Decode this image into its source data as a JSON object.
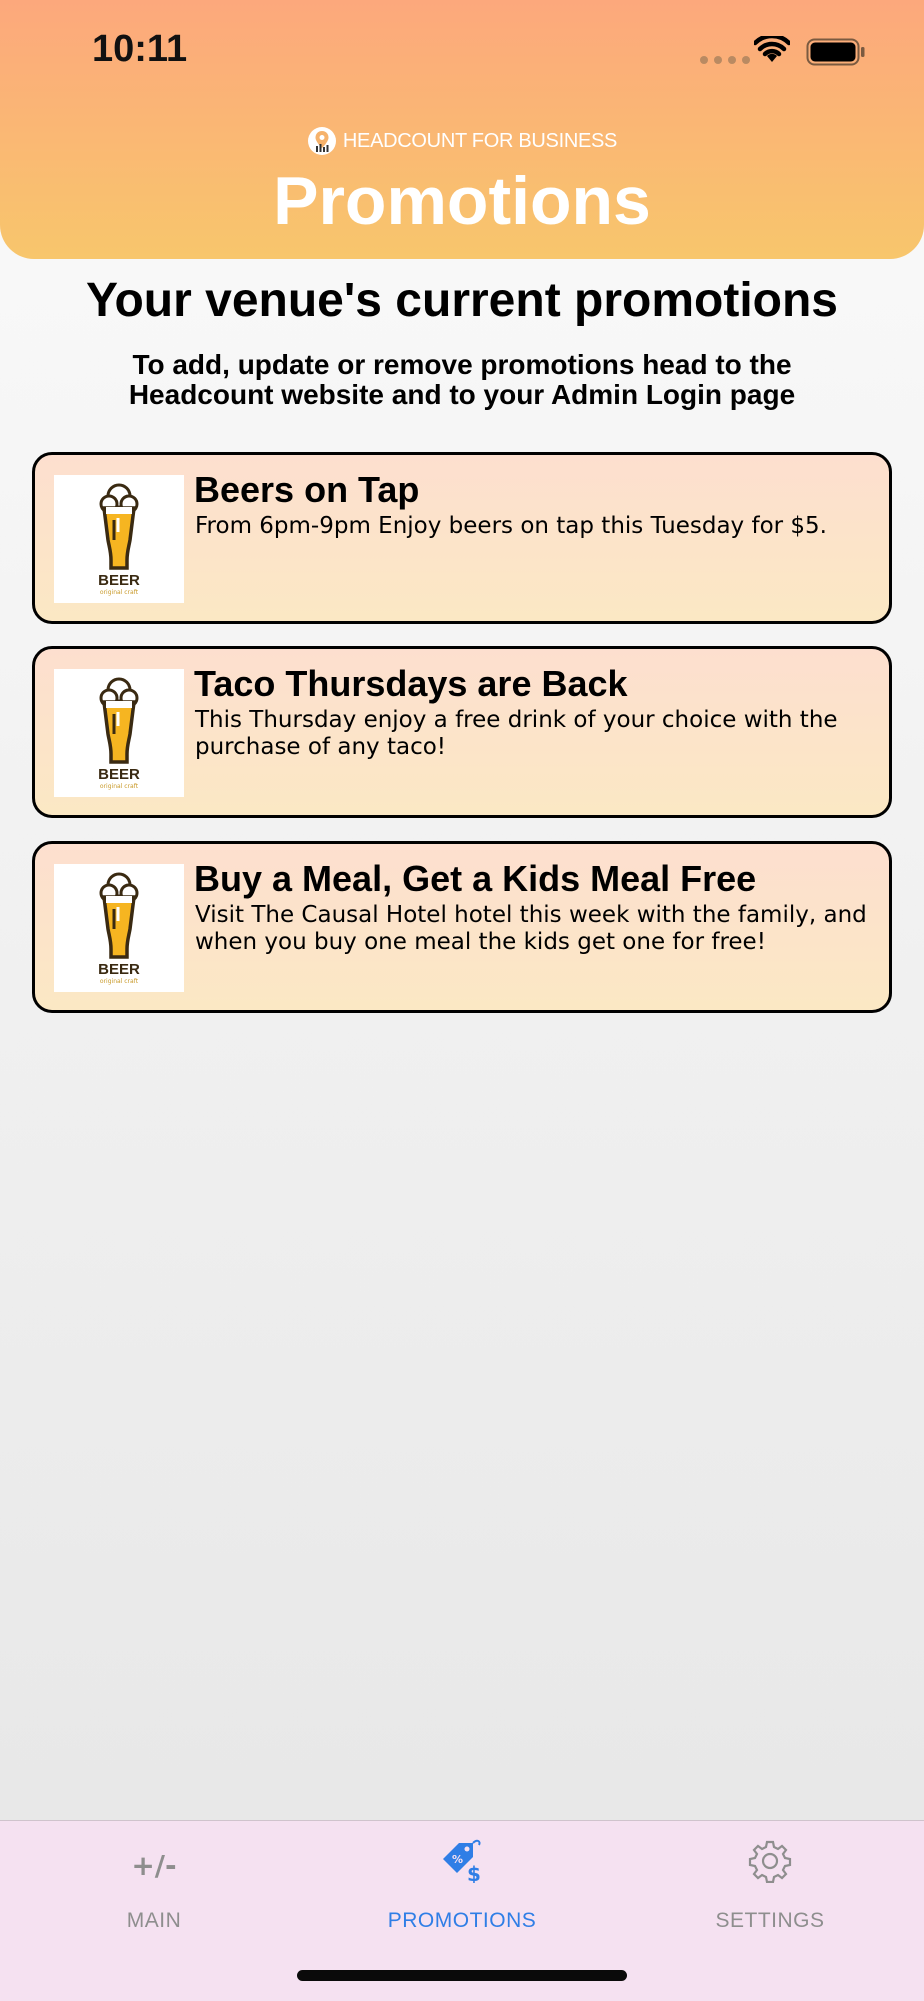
{
  "status_bar": {
    "time": "10:11"
  },
  "header": {
    "brand": "HEADCOUNT FOR BUSINESS",
    "title": "Promotions"
  },
  "intro": {
    "title": "Your venue's current promotions",
    "subtitle": "To add, update or remove promotions head to the Headcount website and to your Admin Login page"
  },
  "promotions": [
    {
      "title": "Beers on Tap",
      "description": "From 6pm-9pm Enjoy beers on tap this Tuesday for $5.",
      "image_label": "BEER",
      "image_sublabel": "original craft"
    },
    {
      "title": "Taco Thursdays are Back",
      "description": "This Thursday enjoy a free drink of your choice with the purchase of any taco!",
      "image_label": "BEER",
      "image_sublabel": "original craft"
    },
    {
      "title": "Buy a Meal, Get a Kids Meal Free",
      "description": "Visit The Causal Hotel hotel this week with the family, and when you buy one meal the kids get one for free!",
      "image_label": "BEER",
      "image_sublabel": "original craft"
    }
  ],
  "tab_bar": {
    "tabs": [
      {
        "label": "MAIN",
        "icon": "plus-minus-icon",
        "glyph": "+/-",
        "active": false
      },
      {
        "label": "PROMOTIONS",
        "icon": "price-tag-icon",
        "active": true
      },
      {
        "label": "SETTINGS",
        "icon": "gear-icon",
        "active": false
      }
    ]
  },
  "colors": {
    "header_top": "#fca87c",
    "header_bottom": "#f8c66c",
    "card_border": "#000000",
    "tab_active": "#2f7ee6",
    "tab_inactive": "#8e8e8e",
    "tab_bar_bg": "#f5e1f1"
  }
}
